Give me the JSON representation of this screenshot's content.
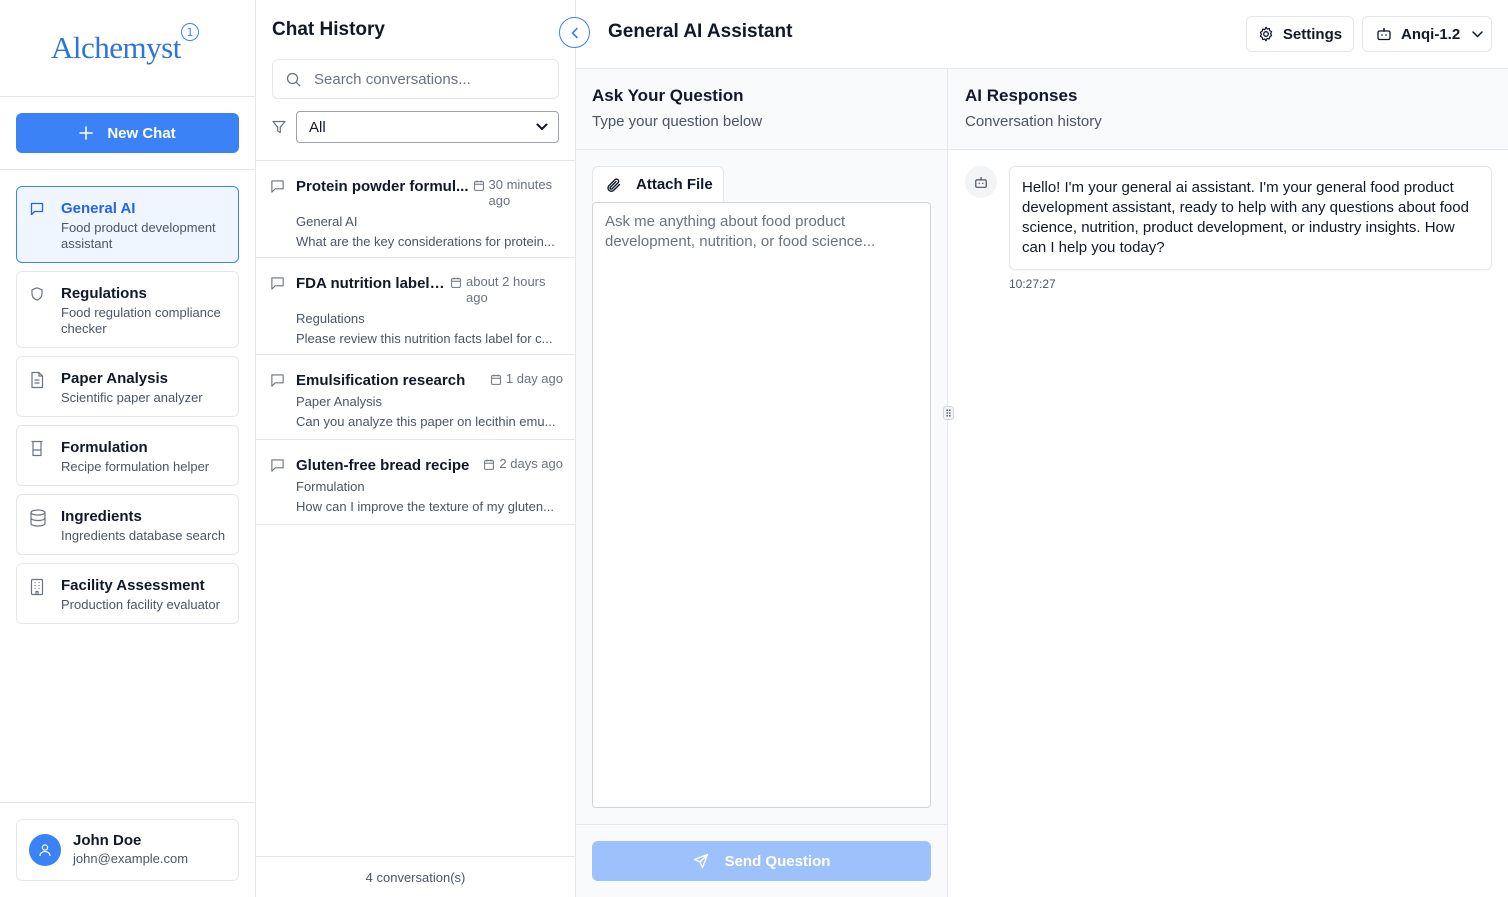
{
  "brand": {
    "name": "Alchemyst",
    "badge": "1"
  },
  "sidebar": {
    "new_chat_label": "New Chat",
    "items": [
      {
        "title": "General AI",
        "subtitle": "Food product development assistant",
        "icon": "message-square-icon",
        "active": true
      },
      {
        "title": "Regulations",
        "subtitle": "Food regulation compliance checker",
        "icon": "shield-icon",
        "active": false
      },
      {
        "title": "Paper Analysis",
        "subtitle": "Scientific paper analyzer",
        "icon": "file-text-icon",
        "active": false
      },
      {
        "title": "Formulation",
        "subtitle": "Recipe formulation helper",
        "icon": "beaker-icon",
        "active": false
      },
      {
        "title": "Ingredients",
        "subtitle": "Ingredients database search",
        "icon": "database-icon",
        "active": false
      },
      {
        "title": "Facility Assessment",
        "subtitle": "Production facility evaluator",
        "icon": "building-icon",
        "active": false
      }
    ],
    "user": {
      "name": "John Doe",
      "email": "john@example.com"
    }
  },
  "history": {
    "title": "Chat History",
    "search_placeholder": "Search conversations...",
    "filter_value": "All",
    "conversations": [
      {
        "title": "Protein powder formul...",
        "time": "30 minutes ago",
        "category": "General AI",
        "preview": "What are the key considerations for protein..."
      },
      {
        "title": "FDA nutrition labeli...",
        "time": "about 2 hours ago",
        "category": "Regulations",
        "preview": "Please review this nutrition facts label for c..."
      },
      {
        "title": "Emulsification research",
        "time": "1 day ago",
        "category": "Paper Analysis",
        "preview": "Can you analyze this paper on lecithin emu..."
      },
      {
        "title": "Gluten-free bread recipe",
        "time": "2 days ago",
        "category": "Formulation",
        "preview": "How can I improve the texture of my gluten..."
      }
    ],
    "count_label": "4 conversation(s)"
  },
  "main": {
    "title": "General AI Assistant",
    "settings_label": "Settings",
    "model_label": "Anqi-1.2",
    "ask": {
      "title": "Ask Your Question",
      "subtitle": "Type your question below",
      "attach_label": "Attach File",
      "placeholder": "Ask me anything about food product development, nutrition, or food science...",
      "send_label": "Send Question"
    },
    "responses": {
      "title": "AI Responses",
      "subtitle": "Conversation history",
      "messages": [
        {
          "text": "Hello! I'm your general ai assistant. I'm your general food product development assistant, ready to help with any questions about food science, nutrition, product development, or industry insights. How can I help you today?",
          "time": "10:27:27"
        }
      ]
    }
  },
  "colors": {
    "accent": "#3b82f6",
    "accent_light": "#eff6ff",
    "send_disabled": "#9dc2fb",
    "border": "#e5e7eb"
  }
}
